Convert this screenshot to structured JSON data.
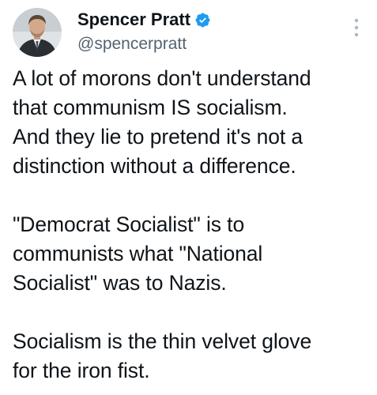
{
  "author": {
    "display_name": "Spencer Pratt",
    "handle": "@spencerpratt",
    "verified_badge_color": "#1d9bf0",
    "avatar": "profile-photo",
    "verified_icon": "verified-badge-icon",
    "more_icon": "more-options-icon"
  },
  "tweet": {
    "paragraphs": [
      {
        "lines": [
          "A lot of morons don't understand",
          "that communism IS socialism.",
          "And they lie to pretend it's not a",
          "distinction without a difference."
        ]
      },
      {
        "lines": [
          "\"Democrat Socialist\" is to",
          "communists what \"National",
          "Socialist\" was to Nazis."
        ]
      },
      {
        "lines": [
          "Socialism is the thin velvet glove",
          "for the iron fist."
        ]
      }
    ]
  }
}
